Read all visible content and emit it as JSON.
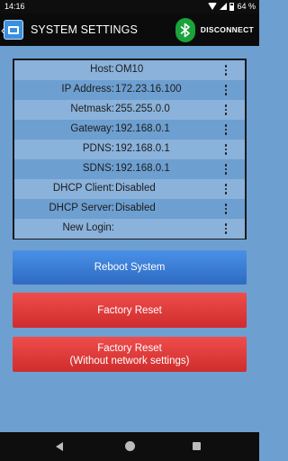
{
  "status_bar": {
    "time": "14:16",
    "battery": "64 %"
  },
  "app_bar": {
    "title": "SYSTEM SETTINGS",
    "disconnect_label": "DISCONNECT"
  },
  "settings": [
    {
      "label": "Host:",
      "value": "OM10"
    },
    {
      "label": "IP Address:",
      "value": "172.23.16.100"
    },
    {
      "label": "Netmask:",
      "value": "255.255.0.0"
    },
    {
      "label": "Gateway:",
      "value": "192.168.0.1"
    },
    {
      "label": "PDNS:",
      "value": "192.168.0.1"
    },
    {
      "label": "SDNS:",
      "value": "192.168.0.1"
    },
    {
      "label": "DHCP Client:",
      "value": "Disabled"
    },
    {
      "label": "DHCP Server:",
      "value": "Disabled"
    },
    {
      "label": "New Login:",
      "value": ""
    }
  ],
  "buttons": {
    "reboot": "Reboot System",
    "factory_reset": "Factory Reset",
    "factory_reset_keep_line1": "Factory Reset",
    "factory_reset_keep_line2": "(Without network settings)"
  },
  "colors": {
    "background": "#6d9fd0",
    "row_alt": "#8ab2db",
    "button_blue": "#3a7fd6",
    "button_red": "#e03b3b",
    "bluetooth": "#1aa33b"
  }
}
